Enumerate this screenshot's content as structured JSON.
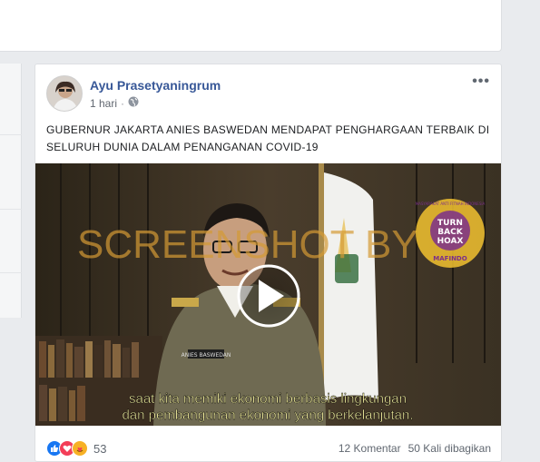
{
  "post": {
    "author": "Ayu Prasetyaningrum",
    "time": "1 hari",
    "privacy_icon": "globe-icon",
    "text": "GUBERNUR JAKARTA ANIES BASWEDAN MENDAPAT PENGHARGAAN TERBAIK DI SELURUH DUNIA DALAM PENANGANAN COVID-19"
  },
  "video": {
    "watermark": "SCREENSHOT BY",
    "badge_ring": "MASYARAKAT ANTI FITNAH INDONESIA",
    "badge_turn": "TURN",
    "badge_back": "BACK",
    "badge_hoax": "HOAX",
    "badge_name": "MAFINDO",
    "subtitle_line1": "saat kita memiki ekonomi berbasis lingkungan",
    "subtitle_line2": "dan pembangunan ekonomi yang berkelanjutan.",
    "name_tag": "ANIES BASWEDAN"
  },
  "footer": {
    "reaction_count": "53",
    "comments": "12 Komentar",
    "shares": "50 Kali dibagikan"
  },
  "colors": {
    "link": "#385898",
    "like": "#1877f2",
    "love": "#f33e58",
    "care": "#f7b125"
  }
}
